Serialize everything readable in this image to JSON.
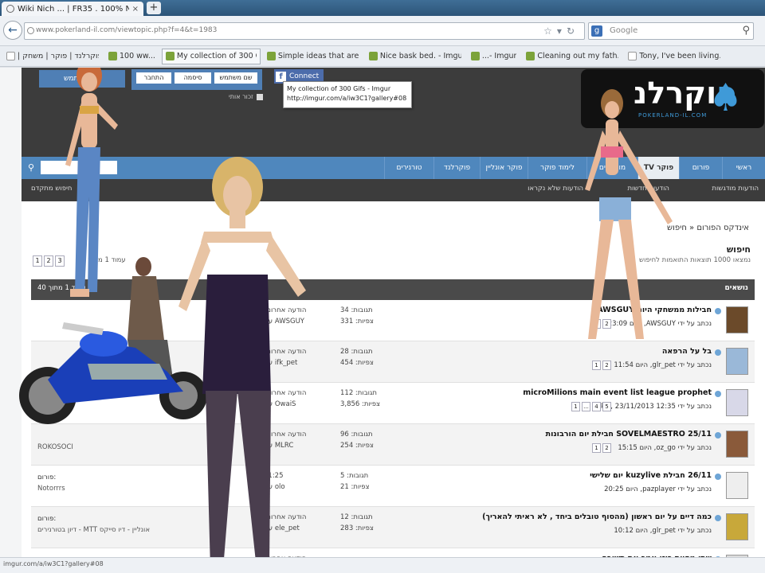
{
  "browser": {
    "tab_title": "Wiki Nich ... | FR35 . 100% Neat...",
    "tab_close": "×",
    "new_tab": "+",
    "url": "www.pokerland-il.com/viewtopic.php?f=4&t=1983",
    "search_engine": "g",
    "search_placeholder": "Google",
    "status_url": "imgur.com/a/iw3C1?gallery#08"
  },
  "bookmarks": [
    {
      "label": "| פוקרלנד | פוקר | משחק",
      "fav": "blank"
    },
    {
      "label": "100 ww...",
      "fav": "green"
    },
    {
      "label": "My collection of 300 G...",
      "fav": "green",
      "active": true
    },
    {
      "label": "Simple ideas that are b...",
      "fav": "green"
    },
    {
      "label": "Nice bask bed. - Imgur",
      "fav": "green"
    },
    {
      "label": "...- Imgur",
      "fav": "green"
    },
    {
      "label": "Cleaning out my fath...",
      "fav": "green"
    },
    {
      "label": "Tony, I've been living...",
      "fav": "blank"
    }
  ],
  "header": {
    "login_user": "שם משתמש",
    "login_field_1": "התחבר",
    "login_field_2": "סיסמה",
    "login_field_3": "שם משתמש",
    "remember": "זכור אותי",
    "fb_connect": "Connect",
    "tooltip_line1": "My collection of 300 Gifs - Imgur",
    "tooltip_line2": "http://imgur.com/a/iw3C1?gallery#08",
    "logo_main": "וקרלנ",
    "logo_blue": "פ",
    "logo_sub": "POKERLAND-IL.COM",
    "logo_spade": "♠"
  },
  "nav": {
    "items": [
      "ראשי",
      "פורום",
      "TV פוקר",
      "מועדונים",
      "לימוד פוקר",
      "פוקר אונליין",
      "פוקרלנד",
      "טורנירים"
    ],
    "subnav": [
      "הודעות מודגשות",
      "הודעות חדשות",
      "הודעות שלא נקראו",
      "חיפוש מתקדם"
    ]
  },
  "content": {
    "breadcrumb": "אינדקס הפורום « חיפוש",
    "heading": "חיפוש",
    "description": "נמצאו 1000 תוצאות התואמות לחיפוש",
    "pagination": [
      "1",
      "2",
      "3"
    ],
    "pagination_label": "עמוד 1 מתוך 40",
    "thread_header_title": "נושאים",
    "thread_header_left": "עמוד 1 מתוך 40"
  },
  "threads": [
    {
      "title": "חבילות ממשחקי היום AWSGUY",
      "meta": "נכתב על ידי AWSGUY, היום 23:09",
      "pages": [
        "1",
        "2"
      ],
      "stats_label": "תגובות: 34",
      "stats_val": "צפיות: 331",
      "last_label": "הודעה אחרונה",
      "last_by": "ע\"י AWSGUY",
      "left_label": "",
      "left_val": ""
    },
    {
      "title": "בל על הרפאה",
      "meta": "נכתב על ידי glr_pet, היום 11:54",
      "pages": [
        "1",
        "2"
      ],
      "stats_label": "תגובות: 28",
      "stats_val": "צפיות: 454",
      "last_label": "הודעה אחרונה",
      "last_by": "ע\"י ifk_pet",
      "left_label": "",
      "left_val": ""
    },
    {
      "title": "microMilions main event list league prophet",
      "meta": "נכתב על ידי dkfs, 23/11/2013 12:35",
      "pages": [
        "1",
        "...",
        "4",
        "5"
      ],
      "stats_label": "תגובות: 112",
      "stats_val": "צפיות: 3,856",
      "last_label": "הודעה אחרונה",
      "last_by": "ע\"י OwaiS",
      "left_label": "",
      "left_val": ""
    },
    {
      "title": "SOVELMAESTRO 25/11 חבילת יום הורבונות",
      "meta": "נכתב על ידי oz_go, היום 15:15",
      "pages": [
        "1",
        "2"
      ],
      "stats_label": "תגובות: 96",
      "stats_val": "צפיות: 254",
      "last_label": "הודעה אחרונה",
      "last_by": "ע\"י MLRC",
      "left_label": "",
      "left_val": "ROKOSOCI"
    },
    {
      "title": "26/11 חבילת kuzylive יום שלישי",
      "meta": "נכתב על ידי pazplayer, היום 20:25",
      "pages": [],
      "stats_label": "תגובות: 5",
      "stats_val": "צפיות: 21",
      "last_label": "21:25",
      "last_by": "ע\"י olo",
      "left_label": "פורום:",
      "left_val": "Notorrrs"
    },
    {
      "title": "כמה דיים על יום ראשון (מהסוף טובלים ביחד , לא ראיתי להאריך)",
      "meta": "נכתב על ידי glr_pet, היום 10:12",
      "pages": [],
      "stats_label": "תגובות: 12",
      "stats_val": "צפיות: 283",
      "last_label": "הודעה אחרונה",
      "last_by": "ע\"י ele_pet",
      "left_label": "פורום:",
      "left_val": "דיון בטורנירים - MTT אונליין - דיו סייקס"
    },
    {
      "title": "שתו מסוית רוזו אמר את תשובה",
      "meta": "",
      "pages": [],
      "stats_label": "",
      "stats_val": "",
      "last_label": "הודעה אחרונה",
      "last_by": "",
      "left_label": "",
      "left_val": ""
    }
  ]
}
